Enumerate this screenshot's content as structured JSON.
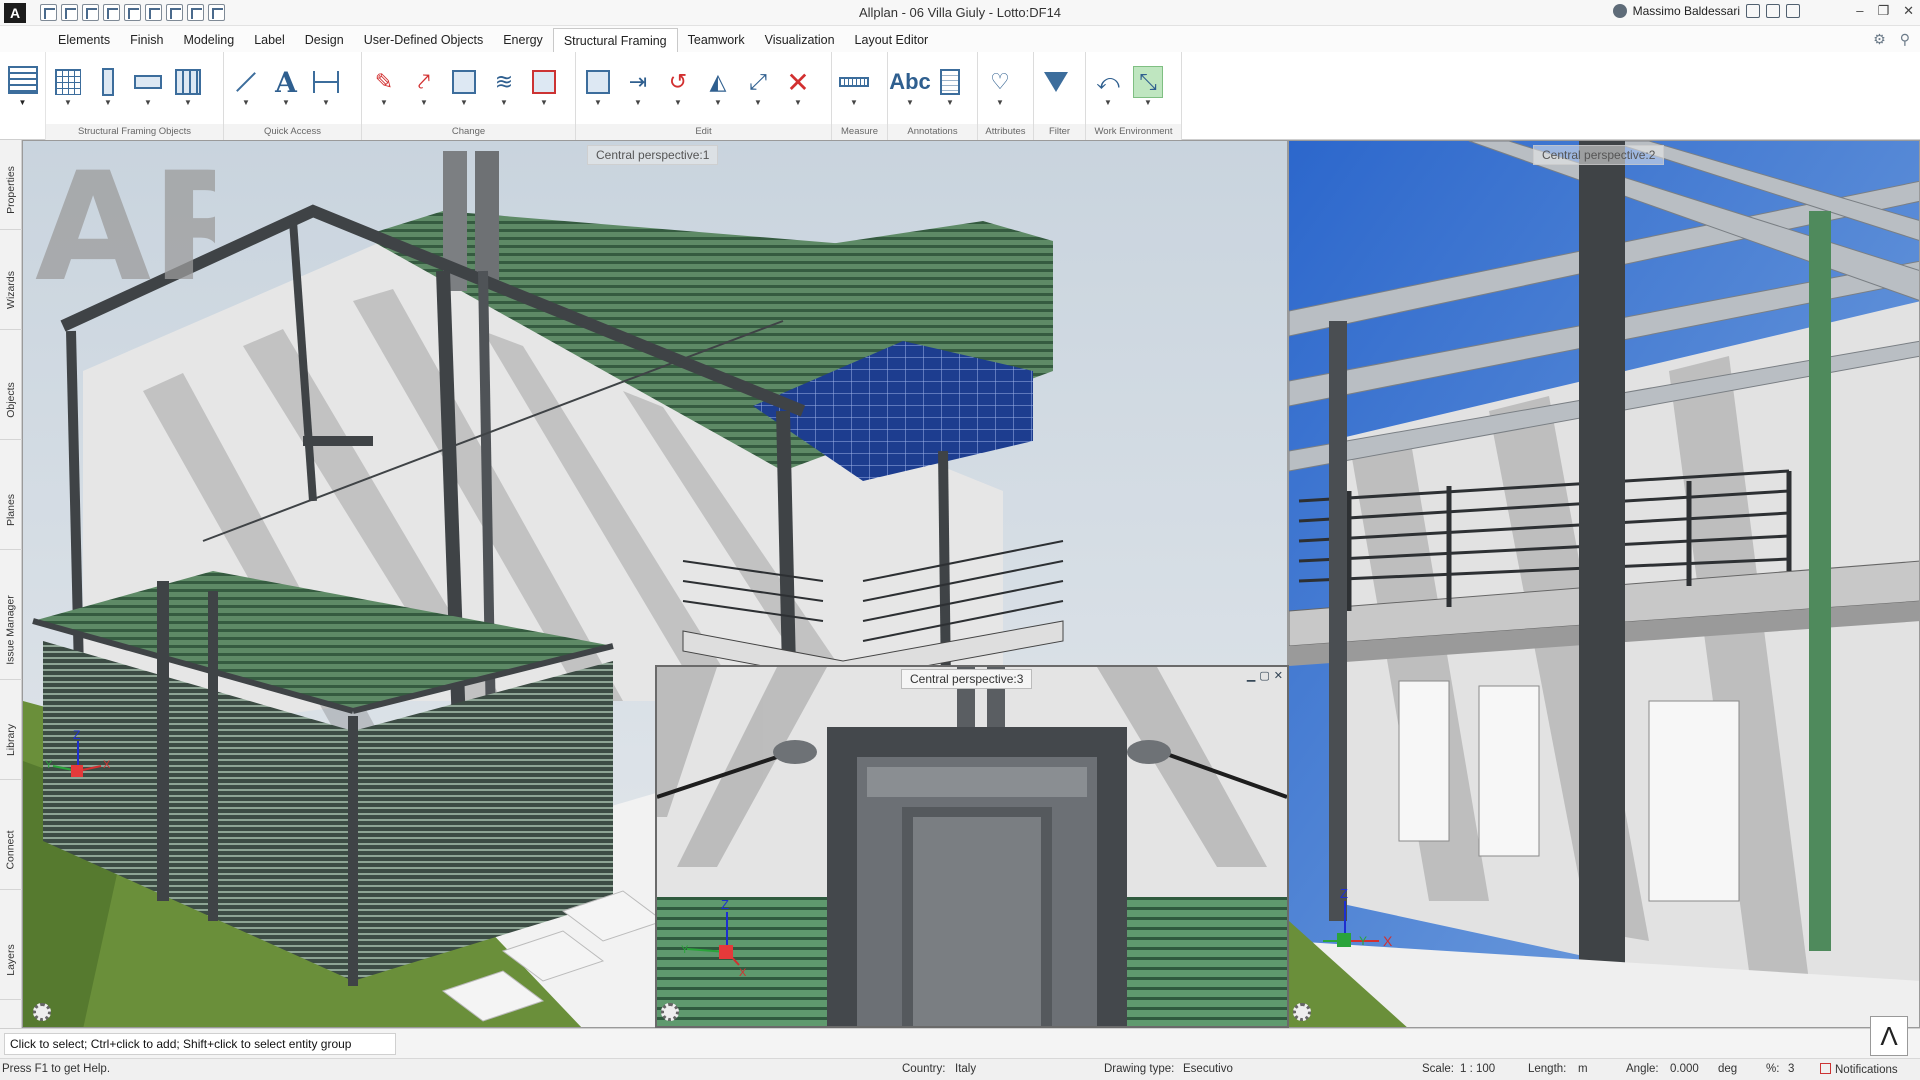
{
  "titlebar": {
    "app_logo": "A",
    "title": "Allplan - 06 Villa Giuly - Lotto:DF14",
    "user": "Massimo Baldessari",
    "qat_icons": [
      "new-icon",
      "open-icon",
      "save-icon",
      "print-icon",
      "undo-icon",
      "redo-icon",
      "select-icon",
      "snap-icon",
      "tools-icon"
    ]
  },
  "menu": {
    "tabs": [
      "Elements",
      "Finish",
      "Modeling",
      "Label",
      "Design",
      "User-Defined Objects",
      "Energy",
      "Structural Framing",
      "Teamwork",
      "Visualization",
      "Layout Editor"
    ],
    "active_index": 7
  },
  "ribbon": {
    "groups": [
      {
        "label": "Structural Framing Objects",
        "tools": [
          "grid-icon",
          "column-icon",
          "beam-icon",
          "wall-icon"
        ]
      },
      {
        "label": "Quick Access",
        "tools": [
          "line-icon",
          "text-icon",
          "dimension-icon"
        ]
      },
      {
        "label": "Change",
        "tools": [
          "eraser-icon",
          "modify-icon",
          "stretch-icon",
          "offset-icon",
          "section-icon"
        ]
      },
      {
        "label": "Edit",
        "tools": [
          "copy-icon",
          "move-icon",
          "rotate-icon",
          "mirror-icon",
          "scale-icon",
          "delete-icon"
        ]
      },
      {
        "label": "Measure",
        "tools": [
          "ruler-icon"
        ]
      },
      {
        "label": "Annotations",
        "tools": [
          "abc-icon",
          "document-icon"
        ]
      },
      {
        "label": "Attributes",
        "tools": [
          "attributes-icon"
        ]
      },
      {
        "label": "Filter",
        "tools": [
          "filter-icon"
        ]
      },
      {
        "label": "Work Environment",
        "tools": [
          "undo-view-icon",
          "active-view-icon"
        ]
      }
    ],
    "text_tool_glyph": "A",
    "abc_glyph": "Abc"
  },
  "sidebar": {
    "tabs": [
      "Properties",
      "Wizards",
      "Objects",
      "Planes",
      "Issue Manager",
      "Library",
      "Connect",
      "Layers"
    ]
  },
  "viewports": {
    "vp1": {
      "label": "Central perspective:1",
      "axes": {
        "z": "Z",
        "y": "Y",
        "x": "X"
      }
    },
    "vp2": {
      "label": "Central perspective:2",
      "axes": {
        "z": "Z",
        "y": "Y",
        "x": "X"
      }
    },
    "vp3": {
      "label": "Central perspective:3",
      "axes": {
        "z": "Z",
        "y": "Y",
        "x": "X"
      }
    }
  },
  "watermark": "ARK",
  "prompt": "Click to select; Ctrl+click to add; Shift+click to select entity group",
  "caret_glyph": "Λ",
  "status": {
    "help": "Press F1 to get Help.",
    "country_label": "Country:",
    "country": "Italy",
    "drawing_type_label": "Drawing type:",
    "drawing_type": "Esecutivo",
    "scale_label": "Scale:",
    "scale": "1 : 100",
    "length_label": "Length:",
    "length": "m",
    "angle_label": "Angle:",
    "angle": "0.000",
    "angle_unit": "deg",
    "percent_label": "%:",
    "percent": "3",
    "notifications": "Notifications"
  },
  "colors": {
    "sky": "#2f6fd0",
    "grass": "#6a8f3a",
    "green_roof": "#4f8a5c",
    "wall": "#e8e8e8",
    "steel": "#3f4346"
  }
}
